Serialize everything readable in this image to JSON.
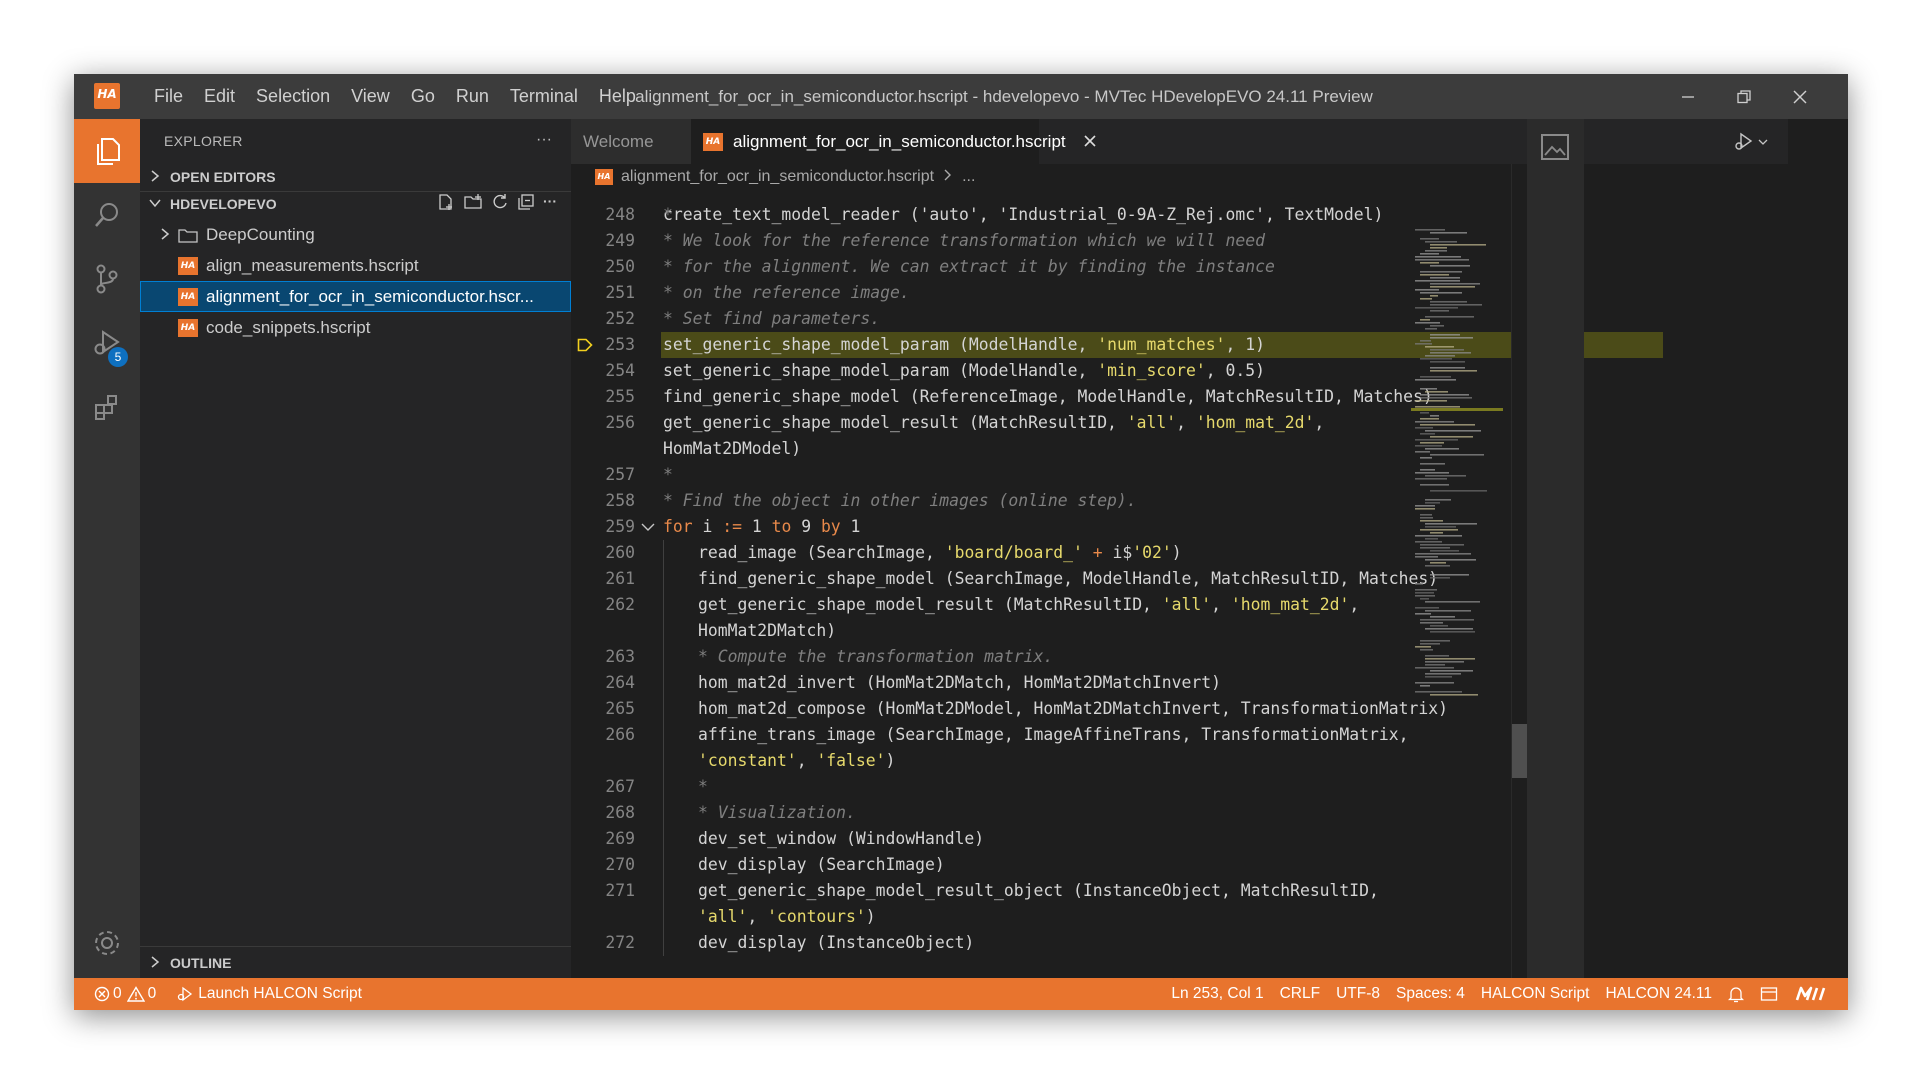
{
  "app": {
    "title": "alignment_for_ocr_in_semiconductor.hscript - hdevelopevo - MVTec HDevelopEVO 24.11 Preview",
    "logo_text": "HA"
  },
  "menu": [
    "File",
    "Edit",
    "Selection",
    "View",
    "Go",
    "Run",
    "Terminal",
    "Help"
  ],
  "activity": {
    "items": [
      {
        "name": "explorer",
        "icon": "files-icon"
      },
      {
        "name": "search",
        "icon": "search-icon"
      },
      {
        "name": "source-control",
        "icon": "source-control-icon"
      },
      {
        "name": "run-debug",
        "icon": "run-debug-icon",
        "badge": "5"
      },
      {
        "name": "extensions",
        "icon": "extensions-icon"
      }
    ],
    "settings_icon": "gear-icon"
  },
  "sidebar": {
    "title": "EXPLORER",
    "more": "···",
    "open_editors": "OPEN EDITORS",
    "workspace": "HDEVELOPEVO",
    "tree": [
      {
        "label": "DeepCounting",
        "type": "folder"
      },
      {
        "label": "align_measurements.hscript",
        "type": "file"
      },
      {
        "label": "alignment_for_ocr_in_semiconductor.hscr...",
        "type": "file",
        "selected": true
      },
      {
        "label": "code_snippets.hscript",
        "type": "file"
      }
    ],
    "outline": "OUTLINE"
  },
  "tabs": [
    {
      "label": "Welcome",
      "active": false
    },
    {
      "label": "alignment_for_ocr_in_semiconductor.hscript",
      "active": true
    }
  ],
  "breadcrumb": {
    "file": "alignment_for_ocr_in_semiconductor.hscript",
    "more": "..."
  },
  "editor": {
    "partial_line": "create_text_model_reader ('auto', 'Industrial_0-9A-Z_Rej.omc', TextModel)",
    "lines": [
      {
        "n": "248",
        "parts": [
          {
            "t": "*",
            "c": "comment"
          }
        ]
      },
      {
        "n": "249",
        "parts": [
          {
            "t": "* We look for the reference transformation which we will need",
            "c": "comment"
          }
        ]
      },
      {
        "n": "250",
        "parts": [
          {
            "t": "* for the alignment. We can extract it by finding the instance",
            "c": "comment"
          }
        ]
      },
      {
        "n": "251",
        "parts": [
          {
            "t": "* on the reference image.",
            "c": "comment"
          }
        ]
      },
      {
        "n": "252",
        "parts": [
          {
            "t": "* Set find parameters.",
            "c": "comment"
          }
        ]
      },
      {
        "n": "253",
        "current": true,
        "parts": [
          {
            "t": "set_generic_shape_model_param (ModelHandle, ",
            "c": "plain"
          },
          {
            "t": "'num_matches'",
            "c": "str"
          },
          {
            "t": ", 1)",
            "c": "plain"
          }
        ]
      },
      {
        "n": "254",
        "parts": [
          {
            "t": "set_generic_shape_model_param (ModelHandle, ",
            "c": "plain"
          },
          {
            "t": "'min_score'",
            "c": "str"
          },
          {
            "t": ", 0.5)",
            "c": "plain"
          }
        ]
      },
      {
        "n": "255",
        "parts": [
          {
            "t": "find_generic_shape_model (ReferenceImage, ModelHandle, MatchResultID, Matches)",
            "c": "plain"
          }
        ]
      },
      {
        "n": "256",
        "parts": [
          {
            "t": "get_generic_shape_model_result (MatchResultID, ",
            "c": "plain"
          },
          {
            "t": "'all'",
            "c": "str"
          },
          {
            "t": ", ",
            "c": "plain"
          },
          {
            "t": "'hom_mat_2d'",
            "c": "str"
          },
          {
            "t": ",",
            "c": "plain"
          }
        ]
      },
      {
        "n": "",
        "parts": [
          {
            "t": "HomMat2DModel)",
            "c": "plain"
          }
        ]
      },
      {
        "n": "257",
        "parts": [
          {
            "t": "*",
            "c": "comment"
          }
        ]
      },
      {
        "n": "258",
        "parts": [
          {
            "t": "* Find the object in other images (online step).",
            "c": "comment"
          }
        ]
      },
      {
        "n": "259",
        "fold": true,
        "parts": [
          {
            "t": "for",
            "c": "kw"
          },
          {
            "t": " i ",
            "c": "plain"
          },
          {
            "t": ":=",
            "c": "kw"
          },
          {
            "t": " 1 ",
            "c": "plain"
          },
          {
            "t": "to",
            "c": "kw"
          },
          {
            "t": " 9 ",
            "c": "plain"
          },
          {
            "t": "by",
            "c": "kw"
          },
          {
            "t": " 1",
            "c": "plain"
          }
        ]
      },
      {
        "n": "260",
        "indent": true,
        "parts": [
          {
            "t": "read_image (SearchImage, ",
            "c": "plain"
          },
          {
            "t": "'board/board_'",
            "c": "str"
          },
          {
            "t": " + ",
            "c": "kw"
          },
          {
            "t": "i$",
            "c": "plain"
          },
          {
            "t": "'02'",
            "c": "str"
          },
          {
            "t": ")",
            "c": "plain"
          }
        ]
      },
      {
        "n": "261",
        "indent": true,
        "parts": [
          {
            "t": "find_generic_shape_model (SearchImage, ModelHandle, MatchResultID, Matches)",
            "c": "plain"
          }
        ]
      },
      {
        "n": "262",
        "indent": true,
        "parts": [
          {
            "t": "get_generic_shape_model_result (MatchResultID, ",
            "c": "plain"
          },
          {
            "t": "'all'",
            "c": "str"
          },
          {
            "t": ", ",
            "c": "plain"
          },
          {
            "t": "'hom_mat_2d'",
            "c": "str"
          },
          {
            "t": ",",
            "c": "plain"
          }
        ]
      },
      {
        "n": "",
        "indent": true,
        "parts": [
          {
            "t": "HomMat2DMatch)",
            "c": "plain"
          }
        ]
      },
      {
        "n": "263",
        "indent": true,
        "parts": [
          {
            "t": "* Compute the transformation matrix.",
            "c": "comment"
          }
        ]
      },
      {
        "n": "264",
        "indent": true,
        "parts": [
          {
            "t": "hom_mat2d_invert (HomMat2DMatch, HomMat2DMatchInvert)",
            "c": "plain"
          }
        ]
      },
      {
        "n": "265",
        "indent": true,
        "parts": [
          {
            "t": "hom_mat2d_compose (HomMat2DModel, HomMat2DMatchInvert, TransformationMatrix)",
            "c": "plain"
          }
        ]
      },
      {
        "n": "266",
        "indent": true,
        "parts": [
          {
            "t": "affine_trans_image (SearchImage, ImageAffineTrans, TransformationMatrix,",
            "c": "plain"
          }
        ]
      },
      {
        "n": "",
        "indent": true,
        "parts": [
          {
            "t": "'constant'",
            "c": "str"
          },
          {
            "t": ", ",
            "c": "plain"
          },
          {
            "t": "'false'",
            "c": "str"
          },
          {
            "t": ")",
            "c": "plain"
          }
        ]
      },
      {
        "n": "267",
        "indent": true,
        "parts": [
          {
            "t": "*",
            "c": "comment"
          }
        ]
      },
      {
        "n": "268",
        "indent": true,
        "parts": [
          {
            "t": "* Visualization.",
            "c": "comment"
          }
        ]
      },
      {
        "n": "269",
        "indent": true,
        "parts": [
          {
            "t": "dev_set_window (WindowHandle)",
            "c": "plain"
          }
        ]
      },
      {
        "n": "270",
        "indent": true,
        "parts": [
          {
            "t": "dev_display (SearchImage)",
            "c": "plain"
          }
        ]
      },
      {
        "n": "271",
        "indent": true,
        "parts": [
          {
            "t": "get_generic_shape_model_result_object (InstanceObject, MatchResultID,",
            "c": "plain"
          }
        ]
      },
      {
        "n": "",
        "indent": true,
        "parts": [
          {
            "t": "'all'",
            "c": "str"
          },
          {
            "t": ", ",
            "c": "plain"
          },
          {
            "t": "'contours'",
            "c": "str"
          },
          {
            "t": ")",
            "c": "plain"
          }
        ]
      },
      {
        "n": "272",
        "indent": true,
        "parts": [
          {
            "t": "dev_display (InstanceObject)",
            "c": "plain"
          }
        ]
      }
    ]
  },
  "statusbar": {
    "errors": "0",
    "warnings": "0",
    "launch": "Launch HALCON Script",
    "position": "Ln 253, Col 1",
    "eol": "CRLF",
    "encoding": "UTF-8",
    "spaces": "Spaces: 4",
    "language": "HALCON Script",
    "halcon_version": "HALCON 24.11",
    "brand": "MVTec"
  },
  "colors": {
    "accent": "#e8742e",
    "selection": "#094771",
    "current_line": "#4b4b18",
    "string": "#e6d96c",
    "keyword": "#e8894a",
    "comment": "#7f7f7f"
  }
}
